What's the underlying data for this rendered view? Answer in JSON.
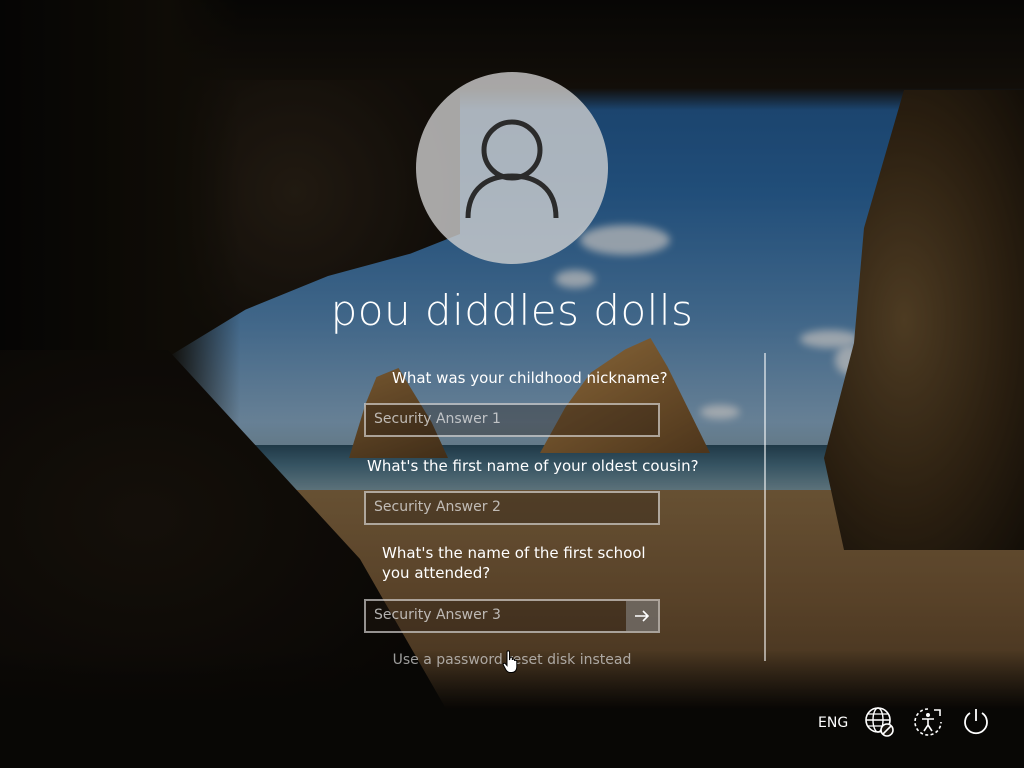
{
  "user": {
    "name": "pou diddles dolls"
  },
  "security_questions": [
    {
      "question": "What was your childhood nickname?",
      "answer_placeholder": "Security Answer 1",
      "answer_value": ""
    },
    {
      "question": "What's the first name of your oldest cousin?",
      "answer_placeholder": "Security Answer 2",
      "answer_value": ""
    },
    {
      "question": "What's the name of the first school you attended?",
      "answer_placeholder": "Security Answer 3",
      "answer_value": ""
    }
  ],
  "submit_icon": "arrow-right-icon",
  "reset_link": "Use a password reset disk instead",
  "tray": {
    "language": "ENG",
    "icons": [
      "network-icon",
      "ease-of-access-icon",
      "power-icon"
    ]
  },
  "colors": {
    "text": "#ffffff",
    "avatar_circle": "#d2d2d2"
  }
}
